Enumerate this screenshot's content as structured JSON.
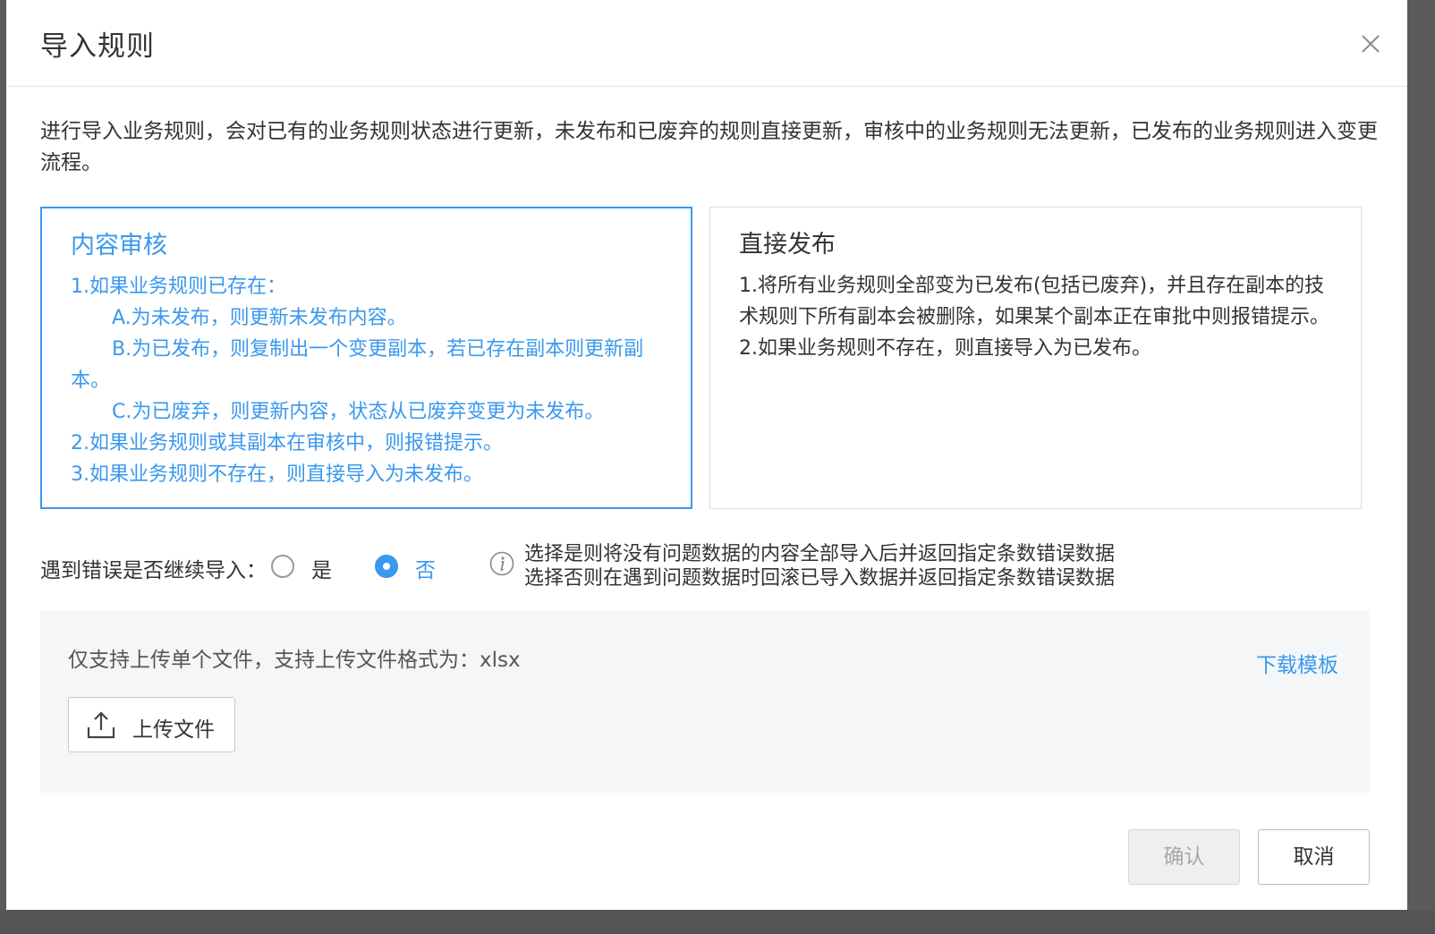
{
  "dialog": {
    "title": "导入规则",
    "intro": "进行导入业务规则，会对已有的业务规则状态进行更新，未发布和已废弃的规则直接更新，审核中的业务规则无法更新，已发布的业务规则进入变更流程。"
  },
  "cards": {
    "audit": {
      "title": "内容审核",
      "selected": true,
      "lines": [
        "1.如果业务规则已存在：",
        "A.为未发布，则更新未发布内容。",
        "B.为已发布，则复制出一个变更副本，若已存在副本则更新副本。",
        "C.为已废弃，则更新内容，状态从已废弃变更为未发布。",
        "2.如果业务规则或其副本在审核中，则报错提示。",
        "3.如果业务规则不存在，则直接导入为未发布。"
      ]
    },
    "publish": {
      "title": "直接发布",
      "selected": false,
      "lines": [
        "1.将所有业务规则全部变为已发布(包括已废弃)，并且存在副本的技术规则下所有副本会被删除，如果某个副本正在审批中则报错提示。",
        "2.如果业务规则不存在，则直接导入为已发布。"
      ]
    }
  },
  "error_option": {
    "label": "遇到错误是否继续导入：",
    "options": [
      "是",
      "否"
    ],
    "selected": "否",
    "hint_lines": [
      "选择是则将没有问题数据的内容全部导入后并返回指定条数错误数据",
      "选择否则在遇到问题数据时回滚已导入数据并返回指定条数错误数据"
    ]
  },
  "upload": {
    "tip": "仅支持上传单个文件，支持上传文件格式为：xlsx",
    "download_label": "下载模板",
    "button_label": "上传文件"
  },
  "footer": {
    "confirm_label": "确认",
    "cancel_label": "取消",
    "confirm_disabled": true
  },
  "colors": {
    "accent": "#3a98ee",
    "text": "#333333",
    "panel_bg": "#f4f6f8"
  },
  "icons": {
    "close": "close-icon",
    "info": "info-icon",
    "upload": "upload-icon"
  }
}
